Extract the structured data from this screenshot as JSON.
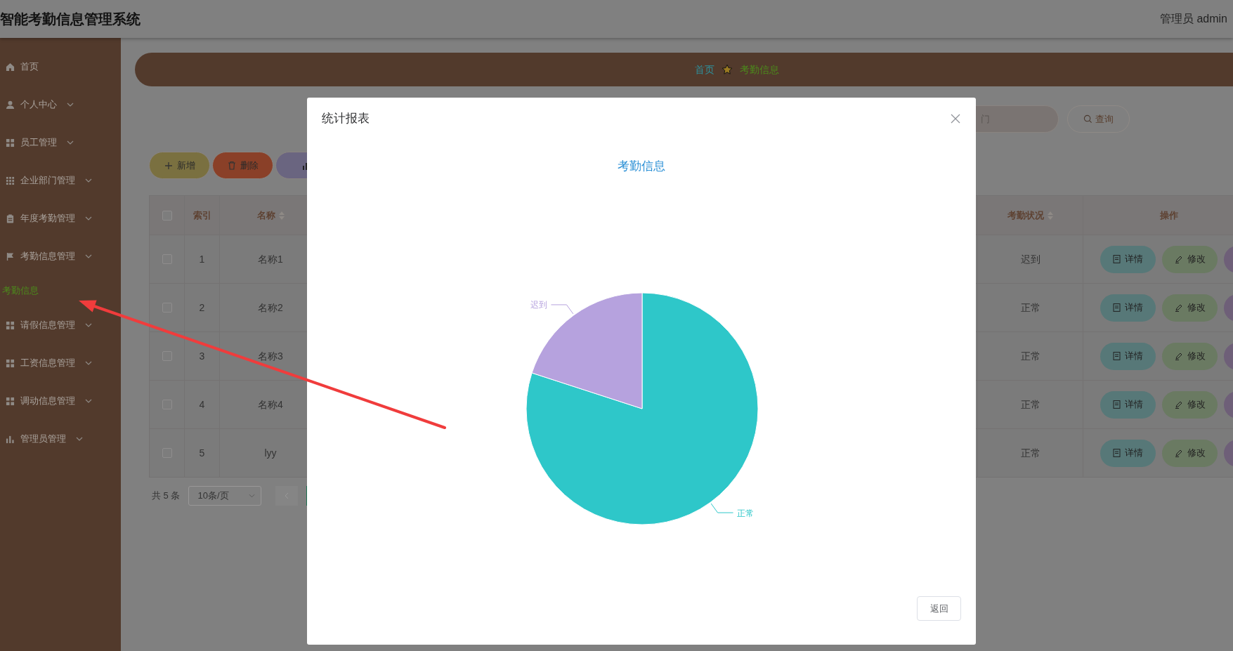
{
  "header": {
    "title": "智能考勤信息管理系统",
    "user": "管理员 admin"
  },
  "sidebar": {
    "items": [
      {
        "label": "首页",
        "kind": "link",
        "selected": false
      },
      {
        "label": "个人中心",
        "kind": "submenu",
        "selected": false
      },
      {
        "label": "员工管理",
        "kind": "submenu",
        "selected": false
      },
      {
        "label": "企业部门管理",
        "kind": "submenu",
        "selected": false
      },
      {
        "label": "年度考勤管理",
        "kind": "submenu",
        "selected": false
      },
      {
        "label": "考勤信息管理",
        "kind": "submenu",
        "selected": false,
        "children": [
          {
            "label": "考勤信息",
            "selected": true
          }
        ]
      },
      {
        "label": "请假信息管理",
        "kind": "submenu",
        "selected": false
      },
      {
        "label": "工资信息管理",
        "kind": "submenu",
        "selected": false
      },
      {
        "label": "调动信息管理",
        "kind": "submenu",
        "selected": false
      },
      {
        "label": "管理员管理",
        "kind": "submenu",
        "selected": false
      }
    ]
  },
  "breadcrumb": [
    "首页",
    "考勤信息"
  ],
  "search": {
    "placeholder": "门",
    "button": "查询"
  },
  "toolbar": [
    {
      "label": "新增",
      "kind": "add"
    },
    {
      "label": "删除",
      "kind": "delete"
    },
    {
      "kind": "chart"
    }
  ],
  "table": {
    "columns": [
      "索引",
      "名称",
      "考勤状况",
      "操作"
    ],
    "all_checked": false,
    "rows": [
      {
        "index": "1",
        "name": "名称1",
        "status": "迟到",
        "checked": false,
        "actions": [
          "详情",
          "修改"
        ]
      },
      {
        "index": "2",
        "name": "名称2",
        "status": "正常",
        "checked": false,
        "actions": [
          "详情",
          "修改"
        ]
      },
      {
        "index": "3",
        "name": "名称3",
        "status": "正常",
        "checked": false,
        "actions": [
          "详情",
          "修改"
        ]
      },
      {
        "index": "4",
        "name": "名称4",
        "status": "正常",
        "checked": false,
        "actions": [
          "详情",
          "修改"
        ]
      },
      {
        "index": "5",
        "name": "lyy",
        "status": "正常",
        "checked": false,
        "actions": [
          "详情",
          "修改"
        ]
      }
    ]
  },
  "pagination": {
    "total": "共 5 条",
    "page_size": "10条/页"
  },
  "dialog": {
    "title": "统计报表",
    "chart_data": {
      "type": "pie",
      "title": "考勤信息",
      "categories": [
        "正常",
        "迟到"
      ],
      "values": [
        80,
        20
      ],
      "colors": [
        "#2ec7c9",
        "#b6a2de"
      ]
    },
    "button": "返回"
  }
}
